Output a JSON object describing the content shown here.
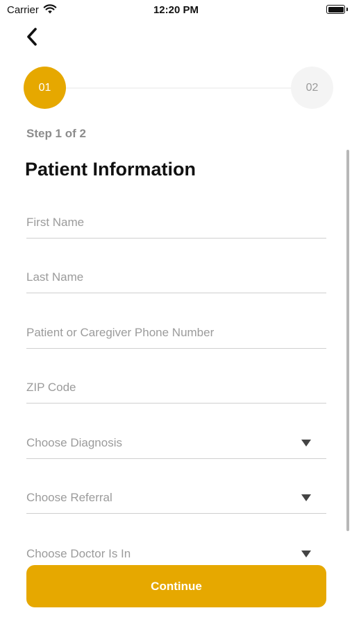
{
  "status_bar": {
    "carrier": "Carrier",
    "time": "12:20 PM"
  },
  "stepper": {
    "steps": [
      {
        "label": "01",
        "active": true
      },
      {
        "label": "02",
        "active": false
      }
    ],
    "indicator": "Step 1 of 2",
    "accent_color": "#E6A800"
  },
  "page": {
    "title": "Patient Information"
  },
  "form": {
    "fields": [
      {
        "placeholder": "First Name",
        "type": "text"
      },
      {
        "placeholder": "Last Name",
        "type": "text"
      },
      {
        "placeholder": "Patient or Caregiver Phone Number",
        "type": "text"
      },
      {
        "placeholder": "ZIP Code",
        "type": "text"
      },
      {
        "placeholder": "Choose Diagnosis",
        "type": "select"
      },
      {
        "placeholder": "Choose Referral",
        "type": "select"
      },
      {
        "placeholder": "Choose Doctor Is In",
        "type": "select"
      }
    ]
  },
  "actions": {
    "continue_label": "Continue"
  },
  "icons": {
    "back": "chevron-left-icon",
    "wifi": "wifi-icon",
    "battery": "battery-icon",
    "dropdown": "caret-down-icon"
  }
}
